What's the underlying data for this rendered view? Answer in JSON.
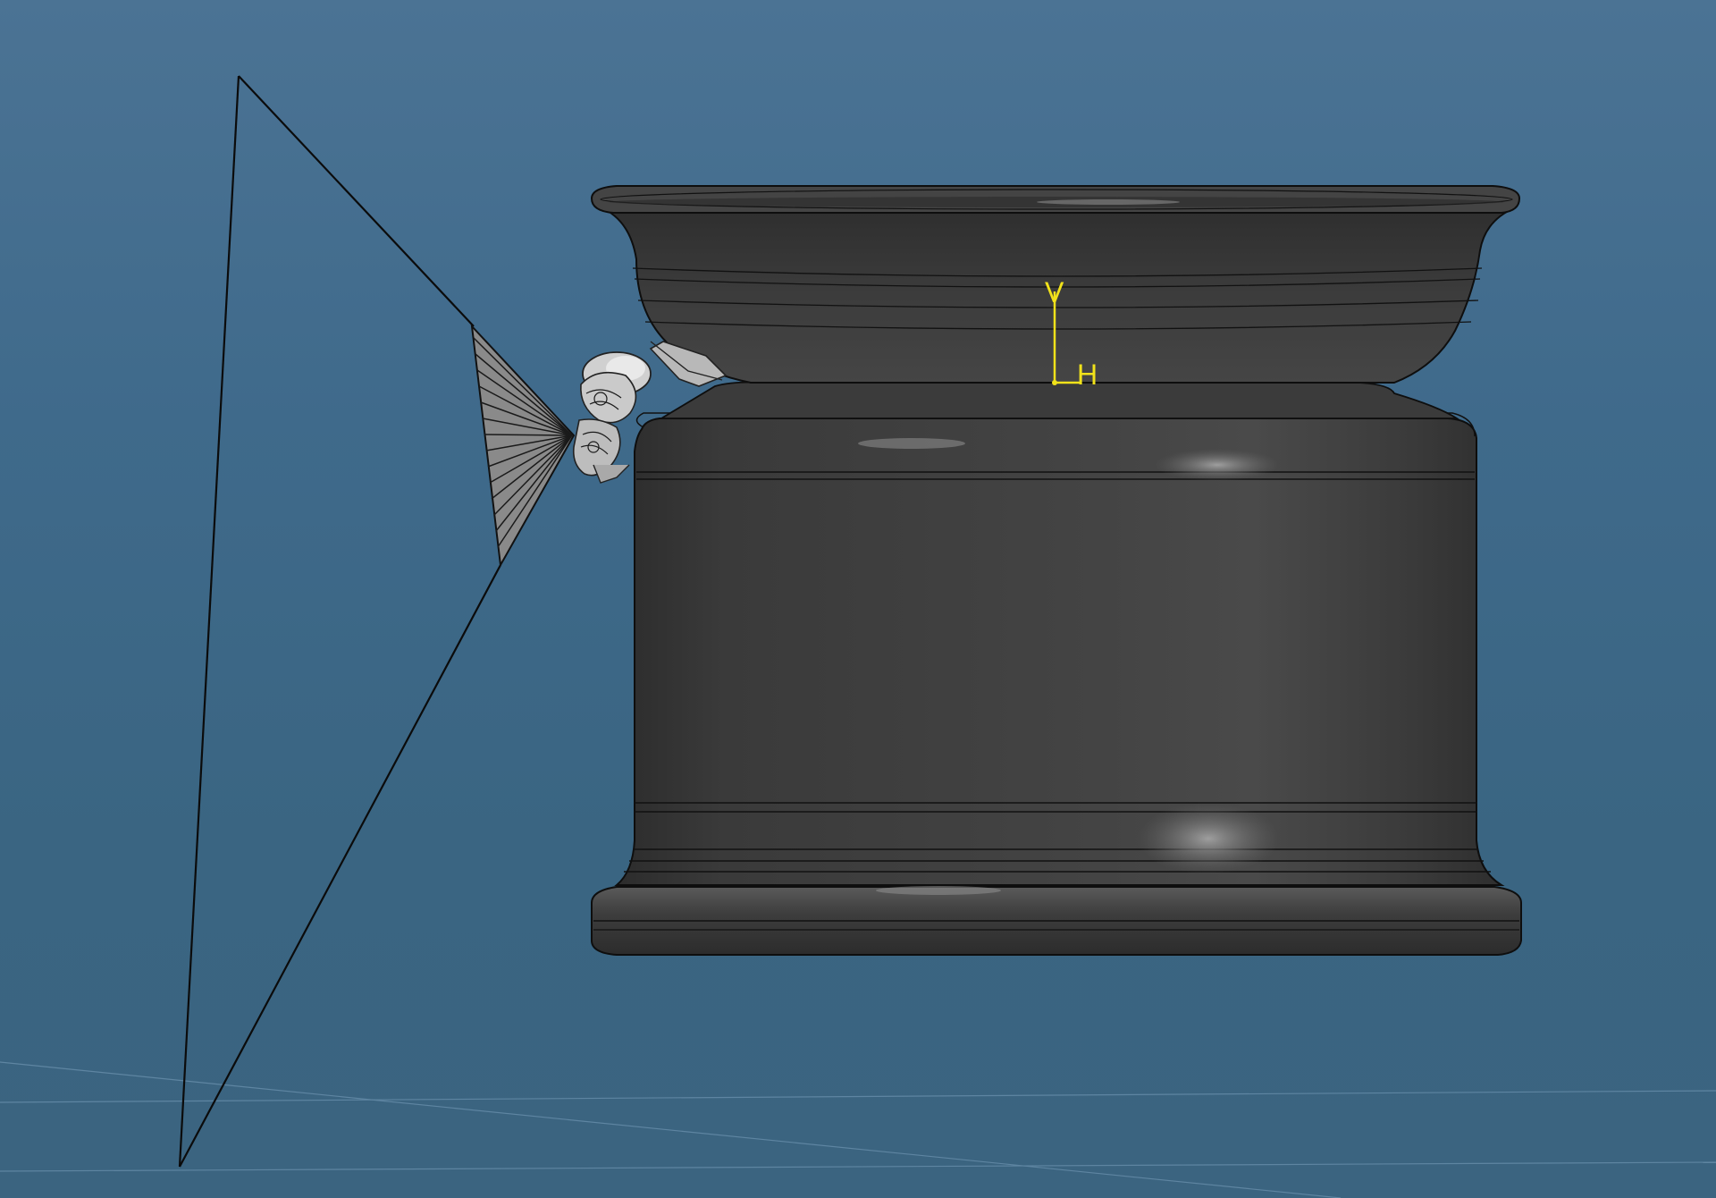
{
  "viewport": {
    "background_top": "#4b7394",
    "background_bottom": "#3b6480"
  },
  "compass": {
    "v_label": "V",
    "h_label": "H",
    "color": "#f1e21a"
  },
  "model": {
    "rim_body_color": "#3b3b3b",
    "edge_color": "#111111",
    "part_color": "#c9c9c9"
  },
  "icons": {
    "projection_frustum": "pyramid-wireframe",
    "sensor_part": "nozzle-assembly"
  }
}
